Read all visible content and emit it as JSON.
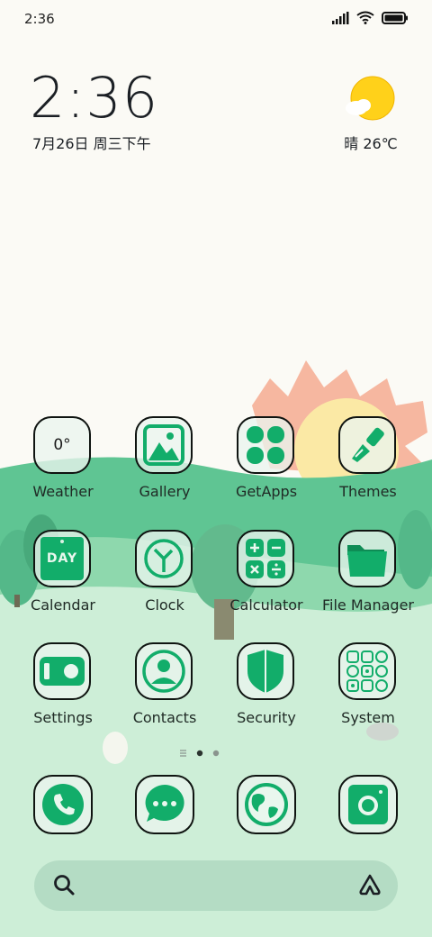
{
  "status_bar": {
    "time": "2:36"
  },
  "clock_widget": {
    "time": "2:36",
    "date": "7月26日 周三下午"
  },
  "weather_widget": {
    "condition_temp": "晴 26℃",
    "icon": "sun-cloud-icon"
  },
  "apps": [
    {
      "label": "Weather",
      "icon": "weather-icon",
      "tile_text": "0°"
    },
    {
      "label": "Gallery",
      "icon": "gallery-icon"
    },
    {
      "label": "GetApps",
      "icon": "clover-icon"
    },
    {
      "label": "Themes",
      "icon": "brush-icon"
    },
    {
      "label": "Calendar",
      "icon": "calendar-icon",
      "tile_text": "DAY"
    },
    {
      "label": "Clock",
      "icon": "clock-icon"
    },
    {
      "label": "Calculator",
      "icon": "calculator-icon"
    },
    {
      "label": "File Manager",
      "icon": "folder-icon"
    },
    {
      "label": "Settings",
      "icon": "toggle-icon"
    },
    {
      "label": "Contacts",
      "icon": "person-icon"
    },
    {
      "label": "Security",
      "icon": "shield-icon"
    },
    {
      "label": "System",
      "icon": "grid-icon"
    }
  ],
  "page_indicator": {
    "current": 2,
    "total": 3
  },
  "dock": [
    {
      "name": "phone-icon"
    },
    {
      "name": "messages-icon"
    },
    {
      "name": "browser-icon"
    },
    {
      "name": "camera-icon"
    }
  ],
  "colors": {
    "accent": "#12ad6a",
    "outline": "#0f1411",
    "hill_dark": "#5fc593",
    "meadow": "#cdeed7",
    "sun": "#ffd11a"
  }
}
